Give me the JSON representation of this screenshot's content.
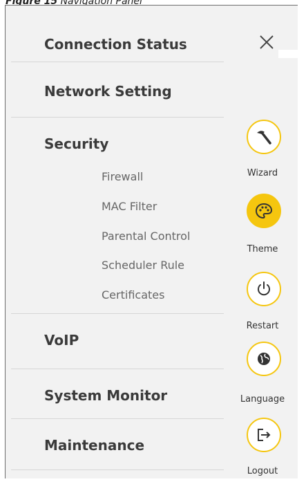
{
  "caption": {
    "figure": "Figure 15",
    "title": "Navigation Panel"
  },
  "menu": {
    "items": [
      {
        "label": "Connection Status"
      },
      {
        "label": "Network Setting"
      },
      {
        "label": "Security"
      },
      {
        "label": "VoIP"
      },
      {
        "label": "System Monitor"
      },
      {
        "label": "Maintenance"
      }
    ],
    "security_sub": [
      {
        "label": "Firewall"
      },
      {
        "label": "MAC Filter"
      },
      {
        "label": "Parental Control"
      },
      {
        "label": "Scheduler Rule"
      },
      {
        "label": "Certificates"
      }
    ]
  },
  "side": {
    "buttons": [
      {
        "label": "Wizard",
        "icon": "wand-icon"
      },
      {
        "label": "Theme",
        "icon": "palette-icon",
        "active": true
      },
      {
        "label": "Restart",
        "icon": "power-icon"
      },
      {
        "label": "Language",
        "icon": "globe-icon"
      },
      {
        "label": "Logout",
        "icon": "logout-icon"
      }
    ]
  },
  "colors": {
    "accent": "#f5c60f",
    "panel_bg": "#f2f2f2",
    "text": "#3a3a3a"
  }
}
